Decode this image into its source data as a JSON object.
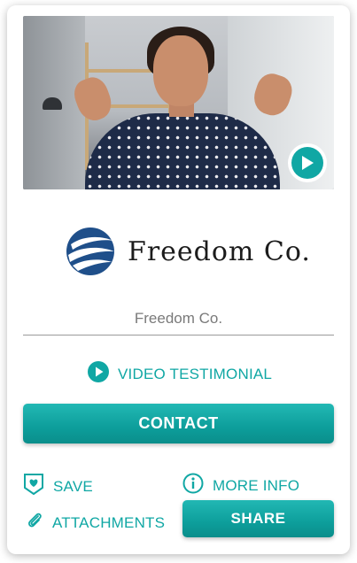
{
  "video": {
    "play_icon": "play-circle-icon"
  },
  "brand": {
    "name": "Freedom Co.",
    "logo_icon": "globe-swoosh-logo",
    "logo_color": "#1f4f8a"
  },
  "company_field": {
    "value": "Freedom Co."
  },
  "video_testimonial": {
    "label": "VIDEO TESTIMONIAL",
    "icon": "play-circle-icon"
  },
  "actions": {
    "contact_label": "CONTACT",
    "save_label": "SAVE",
    "save_icon": "heart-badge-icon",
    "more_info_label": "MORE INFO",
    "more_info_icon": "info-circle-icon",
    "attachments_label": "ATTACHMENTS",
    "attachments_icon": "paperclip-icon",
    "share_label": "SHARE"
  },
  "colors": {
    "accent": "#10a7a4",
    "text_dark": "#1c1c1c",
    "text_muted": "#7a7a7a"
  }
}
